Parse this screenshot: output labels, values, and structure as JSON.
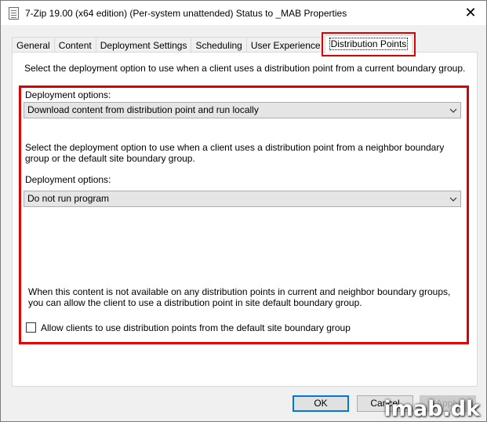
{
  "window": {
    "title": "7-Zip 19.00 (x64 edition) (Per-system unattended) Status to _MAB Properties",
    "close_glyph": "✕"
  },
  "tabs": [
    {
      "label": "General"
    },
    {
      "label": "Content"
    },
    {
      "label": "Deployment Settings"
    },
    {
      "label": "Scheduling"
    },
    {
      "label": "User Experience"
    },
    {
      "label": "Distribution Points",
      "active": true
    }
  ],
  "panel": {
    "current_boundary_description": "Select the deployment option to use when a client uses a distribution point from a current boundary group.",
    "deployment_options_label_1": "Deployment options:",
    "deployment_option_1_value": "Download content from distribution point and run locally",
    "neighbor_boundary_description": "Select the deployment option to use when a client uses a distribution point from a neighbor boundary group or the default site boundary group.",
    "deployment_options_label_2": "Deployment options:",
    "deployment_option_2_value": "Do not run program",
    "fallback_note": "When this content is not available on any distribution points in current and neighbor boundary groups, you can allow the client to use a distribution point in site default boundary group.",
    "allow_default_site_checkbox_label": "Allow clients to use distribution points from the default site boundary group",
    "allow_default_site_checked": false
  },
  "buttons": {
    "ok": "OK",
    "cancel": "Cancel",
    "apply": "Apply"
  },
  "watermark": "imab.dk",
  "colors": {
    "highlight_red": "#e00000",
    "focus_blue": "#0078d7"
  },
  "icons": {
    "window_icon": "document-properties-icon",
    "dropdown": "chevron-down-icon",
    "close": "close-icon"
  }
}
